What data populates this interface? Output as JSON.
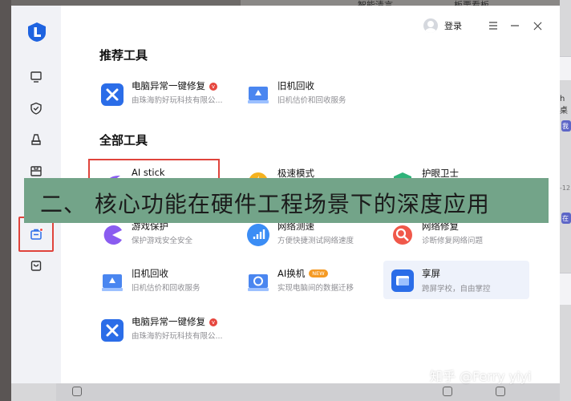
{
  "background": {
    "top_tabs": [
      "智能清言",
      "板栗看板"
    ],
    "right_chars": [
      "h桌",
      "我",
      "-12",
      "在"
    ]
  },
  "window": {
    "login_label": "登录",
    "recommended_title": "推荐工具",
    "all_title": "全部工具",
    "recommended": [
      {
        "name": "电脑异常一键修复",
        "desc": "由珠海豹好玩科技有限公...",
        "icon": "repair-tools-icon",
        "badge": "v"
      },
      {
        "name": "旧机回收",
        "desc": "旧机估价和回收服务",
        "icon": "recycle-icon"
      }
    ],
    "tools": [
      {
        "name": "AI stick",
        "desc": "",
        "icon": "ai-stick-icon"
      },
      {
        "name": "极速模式",
        "desc": "",
        "icon": "speed-mode-icon"
      },
      {
        "name": "护眼卫士",
        "desc": "",
        "icon": "eye-guard-icon"
      },
      {
        "name": "游戏保护",
        "desc": "保护游戏安全安全",
        "icon": "game-protect-icon"
      },
      {
        "name": "网络测速",
        "desc": "方便快捷测试网络速度",
        "icon": "network-speed-icon"
      },
      {
        "name": "网络修复",
        "desc": "诊断修复网络问题",
        "icon": "network-repair-icon"
      },
      {
        "name": "旧机回收",
        "desc": "旧机估价和回收服务",
        "icon": "recycle-icon"
      },
      {
        "name": "AI换机",
        "desc": "实现电脑间的数据迁移",
        "icon": "ai-migrate-icon",
        "badge": "NEW"
      },
      {
        "name": "享屏",
        "desc": "跨屏学校，自由掌控",
        "icon": "screen-share-icon"
      },
      {
        "name": "电脑异常一键修复",
        "desc": "由珠海豹好玩科技有限公...",
        "icon": "repair-tools-icon",
        "badge": "v"
      }
    ]
  },
  "overlay": {
    "caption": "二、 核心功能在硬件工程场景下的深度应用"
  },
  "watermark": "知乎 @Ferry yiyi",
  "colors": {
    "accent_blue": "#2b6de8",
    "highlight_red": "#e0443c",
    "overlay_green": "#73a489"
  }
}
